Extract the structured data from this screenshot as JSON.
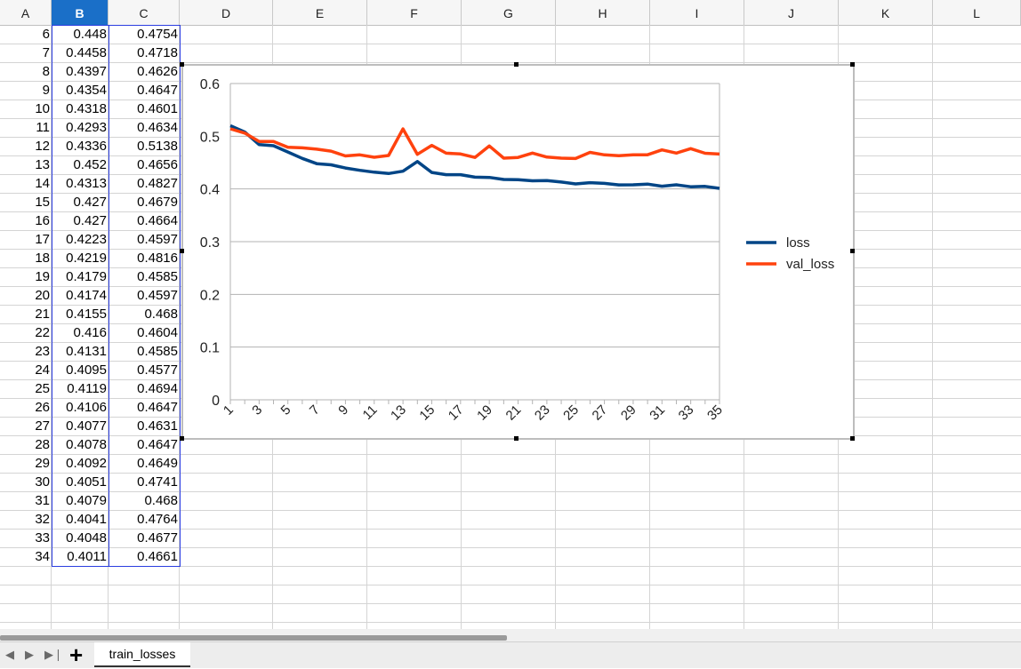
{
  "columns": [
    {
      "id": "A",
      "label": "A",
      "selected": false
    },
    {
      "id": "B",
      "label": "B",
      "selected": true
    },
    {
      "id": "C",
      "label": "C",
      "selected": false
    },
    {
      "id": "D",
      "label": "D",
      "selected": false
    },
    {
      "id": "E",
      "label": "E",
      "selected": false
    },
    {
      "id": "F",
      "label": "F",
      "selected": false
    },
    {
      "id": "G",
      "label": "G",
      "selected": false
    },
    {
      "id": "H",
      "label": "H",
      "selected": false
    },
    {
      "id": "I",
      "label": "I",
      "selected": false
    },
    {
      "id": "J",
      "label": "J",
      "selected": false
    },
    {
      "id": "K",
      "label": "K",
      "selected": false
    },
    {
      "id": "L",
      "label": "L",
      "selected": false
    }
  ],
  "rows": [
    [
      "6",
      "0.448",
      "0.4754"
    ],
    [
      "7",
      "0.4458",
      "0.4718"
    ],
    [
      "8",
      "0.4397",
      "0.4626"
    ],
    [
      "9",
      "0.4354",
      "0.4647"
    ],
    [
      "10",
      "0.4318",
      "0.4601"
    ],
    [
      "11",
      "0.4293",
      "0.4634"
    ],
    [
      "12",
      "0.4336",
      "0.5138"
    ],
    [
      "13",
      "0.452",
      "0.4656"
    ],
    [
      "14",
      "0.4313",
      "0.4827"
    ],
    [
      "15",
      "0.427",
      "0.4679"
    ],
    [
      "16",
      "0.427",
      "0.4664"
    ],
    [
      "17",
      "0.4223",
      "0.4597"
    ],
    [
      "18",
      "0.4219",
      "0.4816"
    ],
    [
      "19",
      "0.4179",
      "0.4585"
    ],
    [
      "20",
      "0.4174",
      "0.4597"
    ],
    [
      "21",
      "0.4155",
      "0.468"
    ],
    [
      "22",
      "0.416",
      "0.4604"
    ],
    [
      "23",
      "0.4131",
      "0.4585"
    ],
    [
      "24",
      "0.4095",
      "0.4577"
    ],
    [
      "25",
      "0.4119",
      "0.4694"
    ],
    [
      "26",
      "0.4106",
      "0.4647"
    ],
    [
      "27",
      "0.4077",
      "0.4631"
    ],
    [
      "28",
      "0.4078",
      "0.4647"
    ],
    [
      "29",
      "0.4092",
      "0.4649"
    ],
    [
      "30",
      "0.4051",
      "0.4741"
    ],
    [
      "31",
      "0.4079",
      "0.468"
    ],
    [
      "32",
      "0.4041",
      "0.4764"
    ],
    [
      "33",
      "0.4048",
      "0.4677"
    ],
    [
      "34",
      "0.4011",
      "0.4661"
    ]
  ],
  "colors": {
    "selected_header": "#1a6fc8",
    "selection_border": "#2b3de0",
    "loss": "#004586",
    "val_loss": "#ff420e"
  },
  "chart_data": {
    "type": "line",
    "x": [
      1,
      2,
      3,
      4,
      5,
      6,
      7,
      8,
      9,
      10,
      11,
      12,
      13,
      14,
      15,
      16,
      17,
      18,
      19,
      20,
      21,
      22,
      23,
      24,
      25,
      26,
      27,
      28,
      29,
      30,
      31,
      32,
      33,
      34,
      35
    ],
    "xticks": [
      "1",
      "3",
      "5",
      "7",
      "9",
      "11",
      "13",
      "15",
      "17",
      "19",
      "21",
      "23",
      "25",
      "27",
      "29",
      "31",
      "33",
      "35"
    ],
    "ylim": [
      0,
      0.6
    ],
    "yticks": [
      "0",
      "0.1",
      "0.2",
      "0.3",
      "0.4",
      "0.5",
      "0.6"
    ],
    "grid": true,
    "legend": "right",
    "series": [
      {
        "name": "loss",
        "color": "#004586",
        "values": [
          0.52,
          0.508,
          0.484,
          0.482,
          0.47,
          0.458,
          0.448,
          0.4458,
          0.4397,
          0.4354,
          0.4318,
          0.4293,
          0.4336,
          0.452,
          0.4313,
          0.427,
          0.427,
          0.4223,
          0.4219,
          0.4179,
          0.4174,
          0.4155,
          0.416,
          0.4131,
          0.4095,
          0.4119,
          0.4106,
          0.4077,
          0.4078,
          0.4092,
          0.4051,
          0.4079,
          0.4041,
          0.4048,
          0.4011
        ]
      },
      {
        "name": "val_loss",
        "color": "#ff420e",
        "values": [
          0.514,
          0.506,
          0.49,
          0.49,
          0.479,
          0.478,
          0.4754,
          0.4718,
          0.4626,
          0.4647,
          0.4601,
          0.4634,
          0.5138,
          0.4656,
          0.4827,
          0.4679,
          0.4664,
          0.4597,
          0.4816,
          0.4585,
          0.4597,
          0.468,
          0.4604,
          0.4585,
          0.4577,
          0.4694,
          0.4647,
          0.4631,
          0.4647,
          0.4649,
          0.4741,
          0.468,
          0.4764,
          0.4677,
          0.4661
        ]
      }
    ]
  },
  "sheet_tab": {
    "label": "train_losses"
  },
  "tabbar": {
    "add_label": "+"
  }
}
